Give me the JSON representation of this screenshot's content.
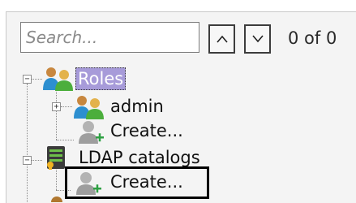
{
  "search": {
    "placeholder": "Search...",
    "value": ""
  },
  "navigation": {
    "counter": "0 of 0"
  },
  "tree": {
    "roles": {
      "label": "Roles",
      "expander": "−"
    },
    "admin": {
      "label": "admin",
      "expander": "+"
    },
    "roles_create": {
      "label": "Create..."
    },
    "ldap": {
      "label": "LDAP catalogs",
      "expander": "−"
    },
    "ldap_create": {
      "label": "Create..."
    }
  },
  "icons": [
    "roles-group-icon",
    "admin-role-icon",
    "create-user-icon",
    "ldap-catalog-icon",
    "up-arrow-icon",
    "down-arrow-icon"
  ],
  "colors": {
    "selection": "#a79bd9",
    "highlight_border": "#000000"
  }
}
